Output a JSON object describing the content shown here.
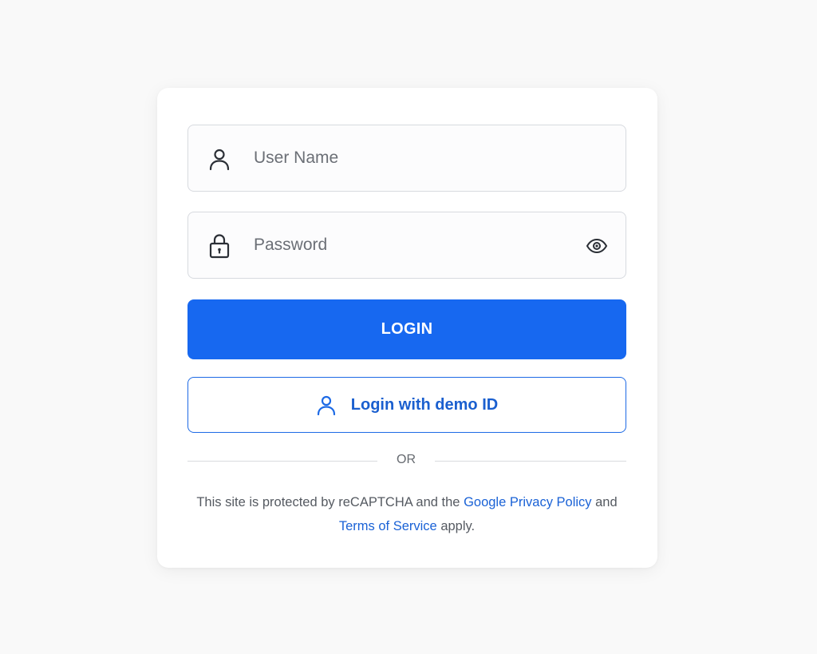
{
  "form": {
    "username": {
      "placeholder": "User Name",
      "value": "",
      "icon": "user-icon"
    },
    "password": {
      "placeholder": "Password",
      "value": "",
      "icon": "lock-icon",
      "toggle_icon": "eye-icon"
    },
    "login_button": "LOGIN",
    "demo_button": {
      "label": "Login with demo ID",
      "icon": "user-icon"
    },
    "divider_text": "OR"
  },
  "legal": {
    "prefix": "This site is protected by reCAPTCHA and the ",
    "privacy_link": "Google Privacy Policy",
    "middle": " and ",
    "terms_link": "Terms of Service",
    "suffix": " apply."
  },
  "colors": {
    "primary": "#1768f0",
    "link": "#1a62d6",
    "background": "#f9f9f9",
    "card": "#ffffff"
  }
}
